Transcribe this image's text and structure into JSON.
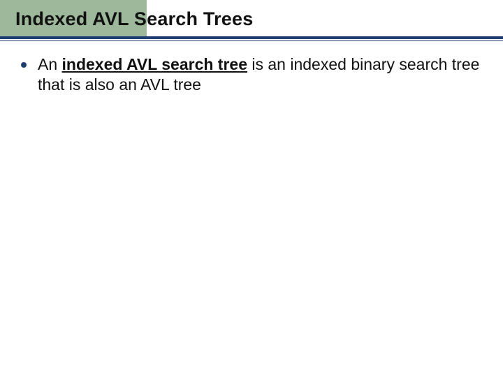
{
  "title": "Indexed AVL Search Trees",
  "bullets": [
    {
      "lead": "An ",
      "term": "indexed AVL search tree",
      "rest": " is an indexed binary search tree that is also an AVL tree"
    }
  ],
  "colors": {
    "accent_band": "#9db89a",
    "rule": "#1f3f73"
  }
}
